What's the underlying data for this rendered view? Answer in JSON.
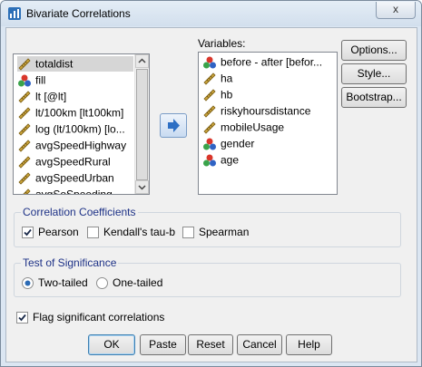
{
  "window": {
    "title": "Bivariate Correlations",
    "close_symbol": "x"
  },
  "left_list": {
    "items": [
      {
        "label": "totaldist",
        "icon": "ruler-icon",
        "selected": true
      },
      {
        "label": "fill",
        "icon": "nominal-icon"
      },
      {
        "label": "lt [@lt]",
        "icon": "ruler-icon"
      },
      {
        "label": "lt/100km [lt100km]",
        "icon": "ruler-icon"
      },
      {
        "label": "log (lt/100km) [lo...",
        "icon": "ruler-icon"
      },
      {
        "label": "avgSpeedHighway",
        "icon": "ruler-icon"
      },
      {
        "label": "avgSpeedRural",
        "icon": "ruler-icon"
      },
      {
        "label": "avgSpeedUrban",
        "icon": "ruler-icon"
      },
      {
        "label": "avgSoSpeeding",
        "icon": "ruler-icon"
      }
    ]
  },
  "variables": {
    "label": "Variables:",
    "items": [
      {
        "label": "before - after  [befor...",
        "icon": "nominal-icon"
      },
      {
        "label": "ha",
        "icon": "ruler-icon"
      },
      {
        "label": "hb",
        "icon": "ruler-icon"
      },
      {
        "label": "riskyhoursdistance",
        "icon": "ruler-icon"
      },
      {
        "label": "mobileUsage",
        "icon": "ruler-icon"
      },
      {
        "label": "gender",
        "icon": "nominal-icon"
      },
      {
        "label": "age",
        "icon": "nominal-icon"
      }
    ]
  },
  "side_buttons": {
    "options": "Options...",
    "style": "Style...",
    "bootstrap": "Bootstrap..."
  },
  "correlation_coefficients": {
    "label": "Correlation Coefficients",
    "pearson": "Pearson",
    "kendall": "Kendall's tau-b",
    "spearman": "Spearman",
    "pearson_checked": true,
    "kendall_checked": false,
    "spearman_checked": false
  },
  "test_of_significance": {
    "label": "Test of Significance",
    "two_tailed": "Two-tailed",
    "one_tailed": "One-tailed",
    "selected": "two"
  },
  "flag": {
    "label": "Flag significant correlations",
    "checked": true
  },
  "bottom_buttons": {
    "ok": "OK",
    "paste": "Paste",
    "reset": "Reset",
    "cancel": "Cancel",
    "help": "Help"
  },
  "colors": {
    "group_label": "#1e3287",
    "ruler": "#c8a23a",
    "nominal_red": "#d9362b",
    "nominal_green": "#3aa34a",
    "nominal_blue": "#2f63c4"
  }
}
